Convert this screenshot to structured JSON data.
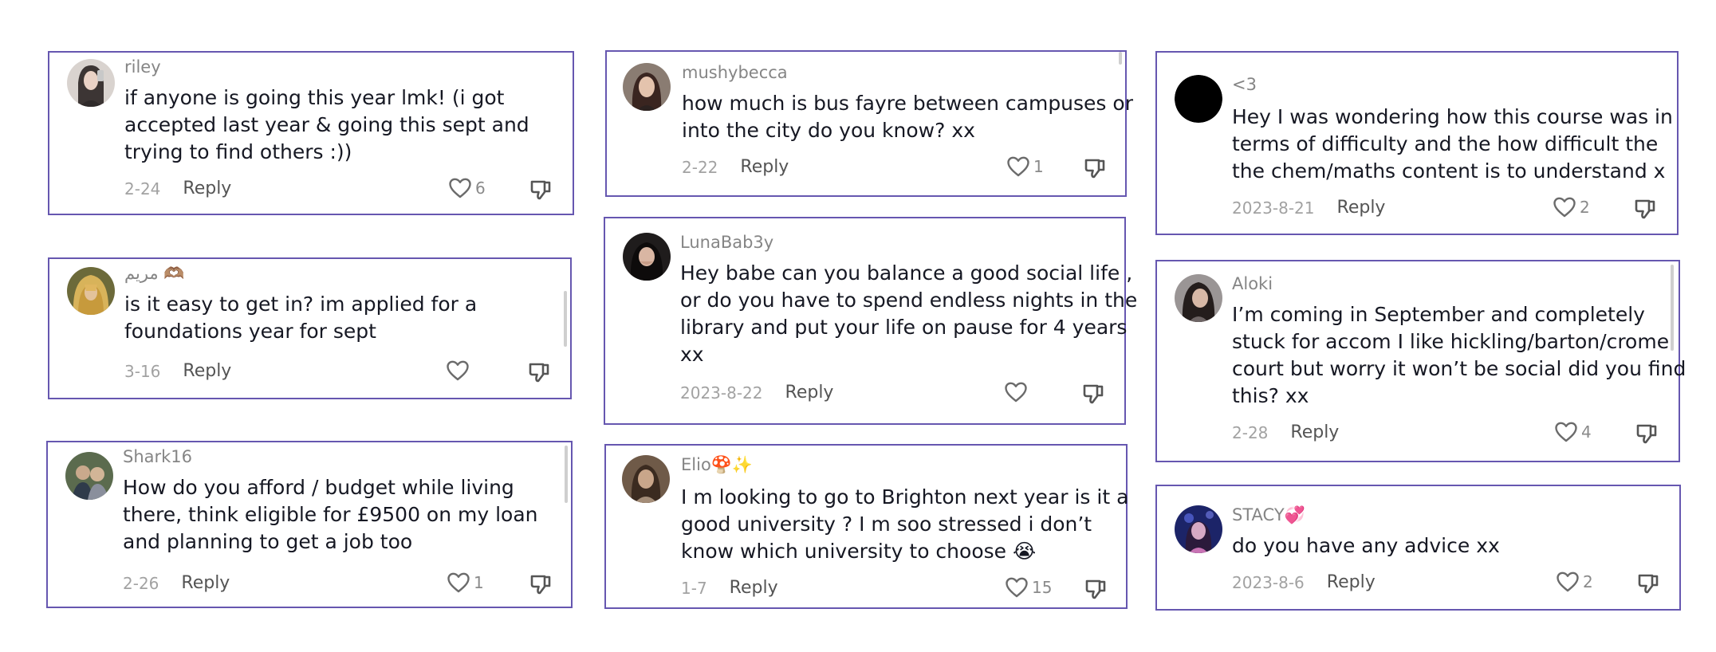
{
  "ui": {
    "reply_label": "Reply",
    "accent_color": "#6657b0"
  },
  "comments": [
    {
      "username": "riley",
      "lines": [
        "if anyone is going this year lmk! (i got",
        "accepted last year & going this sept and",
        "trying to find others :))"
      ],
      "date": "2-24",
      "likes": "6",
      "avatar_icon": "avatar-photo-selfie"
    },
    {
      "username": "مريم 🫶🏽",
      "lines": [
        "is it easy to get in? im applied for a",
        "foundations year for sept"
      ],
      "date": "3-16",
      "likes": "",
      "avatar_icon": "avatar-photo-blonde"
    },
    {
      "username": "Shark16",
      "lines": [
        "How do you afford / budget while living",
        "there, think eligible for £9500 on my loan",
        "and planning to get a job too"
      ],
      "date": "2-26",
      "likes": "1",
      "avatar_icon": "avatar-photo-group"
    },
    {
      "username": "mushybecca",
      "lines": [
        "how much is bus fayre between campuses or",
        "into the city do you know? xx"
      ],
      "date": "2-22",
      "likes": "1",
      "avatar_icon": "avatar-photo-portrait"
    },
    {
      "username": "LunaBab3y",
      "lines": [
        "Hey babe can you balance a good social life ,",
        "or do you have to spend endless nights in the",
        "library and put your life on pause for 4 years",
        "xx"
      ],
      "date": "2023-8-22",
      "likes": "",
      "avatar_icon": "avatar-photo-dark"
    },
    {
      "username": "Elio🍄✨",
      "lines": [
        "I m looking to go to Brighton next year is it a",
        "good university ? I m soo stressed i don’t",
        "know which university to choose 😭"
      ],
      "date": "1-7",
      "likes": "15",
      "avatar_icon": "avatar-photo-brown"
    },
    {
      "username": "<3",
      "lines": [
        "Hey I was wondering how this course was in",
        "terms of difficulty and the how difficult the",
        "the chem/maths content is to understand x"
      ],
      "date": "2023-8-21",
      "likes": "2",
      "avatar_icon": "avatar-black-circle"
    },
    {
      "username": "Aloki",
      "lines": [
        "I’m coming in September and completely",
        "stuck for accom I like hickling/barton/crome",
        "court but worry it won’t be social did you find",
        "this? xx"
      ],
      "date": "2-28",
      "likes": "4",
      "avatar_icon": "avatar-photo-grey"
    },
    {
      "username": "STACY💞",
      "lines": [
        "do you have any advice xx"
      ],
      "date": "2023-8-6",
      "likes": "2",
      "avatar_icon": "avatar-photo-blue"
    }
  ]
}
